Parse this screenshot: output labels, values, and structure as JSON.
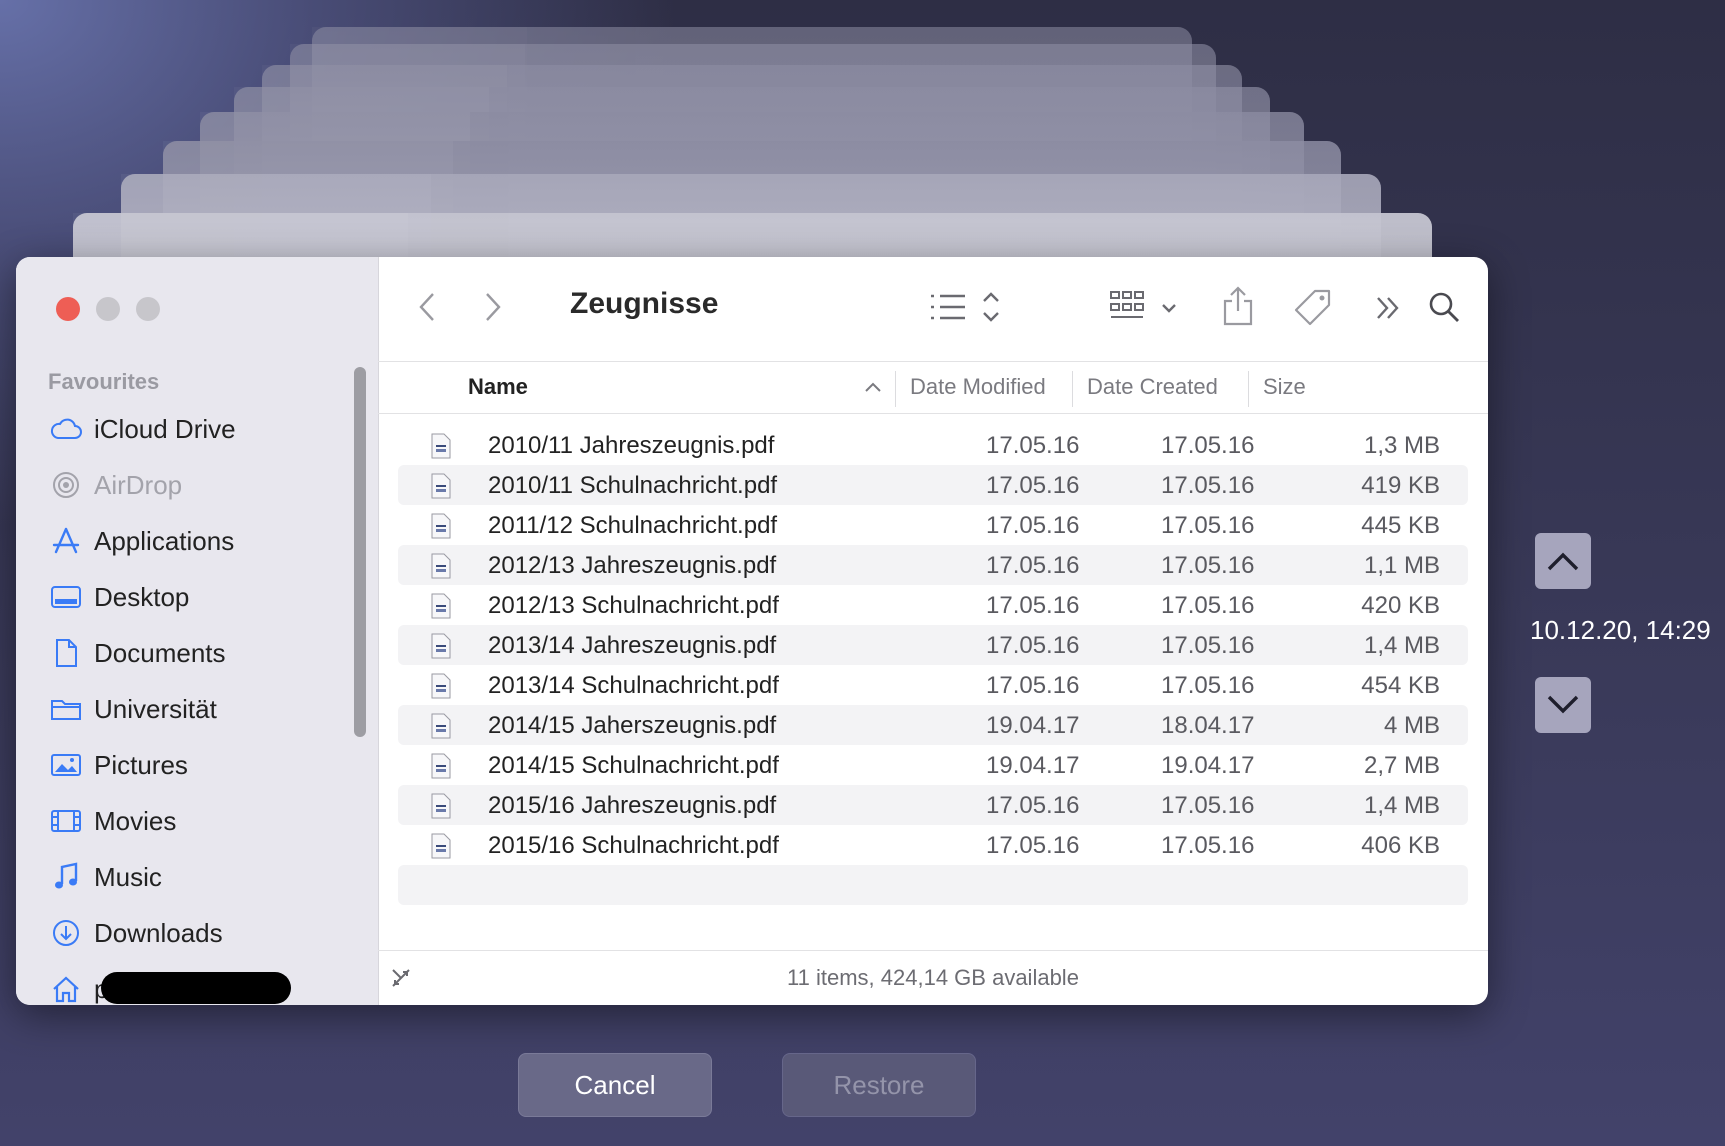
{
  "window": {
    "title": "Zeugnisse",
    "sidebar": {
      "heading": "Favourites",
      "items": [
        {
          "label": "iCloud Drive",
          "icon": "cloud-icon"
        },
        {
          "label": "AirDrop",
          "icon": "airdrop-icon"
        },
        {
          "label": "Applications",
          "icon": "applications-icon"
        },
        {
          "label": "Desktop",
          "icon": "desktop-icon"
        },
        {
          "label": "Documents",
          "icon": "document-icon"
        },
        {
          "label": "Universität",
          "icon": "folder-icon"
        },
        {
          "label": "Pictures",
          "icon": "pictures-icon"
        },
        {
          "label": "Movies",
          "icon": "movies-icon"
        },
        {
          "label": "Music",
          "icon": "music-icon"
        },
        {
          "label": "Downloads",
          "icon": "downloads-icon"
        },
        {
          "label": "p",
          "icon": "home-icon"
        }
      ]
    },
    "columns": {
      "name": "Name",
      "date_modified": "Date Modified",
      "date_created": "Date Created",
      "size": "Size"
    },
    "files": [
      {
        "name": "2010/11 Jahreszeugnis.pdf",
        "modified": "17.05.16",
        "created": "17.05.16",
        "size": "1,3 MB"
      },
      {
        "name": "2010/11 Schulnachricht.pdf",
        "modified": "17.05.16",
        "created": "17.05.16",
        "size": "419 KB"
      },
      {
        "name": "2011/12 Schulnachricht.pdf",
        "modified": "17.05.16",
        "created": "17.05.16",
        "size": "445 KB"
      },
      {
        "name": "2012/13 Jahreszeugnis.pdf",
        "modified": "17.05.16",
        "created": "17.05.16",
        "size": "1,1 MB"
      },
      {
        "name": "2012/13 Schulnachricht.pdf",
        "modified": "17.05.16",
        "created": "17.05.16",
        "size": "420 KB"
      },
      {
        "name": "2013/14 Jahreszeugnis.pdf",
        "modified": "17.05.16",
        "created": "17.05.16",
        "size": "1,4 MB"
      },
      {
        "name": "2013/14 Schulnachricht.pdf",
        "modified": "17.05.16",
        "created": "17.05.16",
        "size": "454 KB"
      },
      {
        "name": "2014/15 Jaherszeugnis.pdf",
        "modified": "19.04.17",
        "created": "18.04.17",
        "size": "4 MB"
      },
      {
        "name": "2014/15 Schulnachricht.pdf",
        "modified": "19.04.17",
        "created": "19.04.17",
        "size": "2,7 MB"
      },
      {
        "name": "2015/16 Jahreszeugnis.pdf",
        "modified": "17.05.16",
        "created": "17.05.16",
        "size": "1,4 MB"
      },
      {
        "name": "2015/16 Schulnachricht.pdf",
        "modified": "17.05.16",
        "created": "17.05.16",
        "size": "406 KB"
      }
    ],
    "status": "11 items, 424,14 GB available"
  },
  "time_machine": {
    "timestamp": "10.12.20, 14:29",
    "cancel_label": "Cancel",
    "restore_label": "Restore"
  },
  "colors": {
    "close": "#ee5e55",
    "accent": "#3a7bf6",
    "inactive_light": "#c7c6cb"
  }
}
